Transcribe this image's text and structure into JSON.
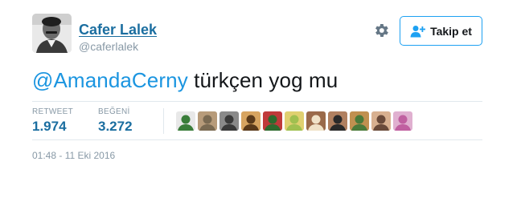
{
  "user": {
    "name": "Cafer Lalek",
    "handle": "@caferlalek",
    "avatar_icon": "profile-photo"
  },
  "actions": {
    "settings_icon": "gear-icon",
    "follow_label": "Takip et",
    "follow_icon": "add-user-icon",
    "accent_color": "#1da1f2"
  },
  "tweet": {
    "mention": "@AmandaCerny",
    "text": " türkçen yog mu"
  },
  "stats": {
    "retweet_label": "RETWEET",
    "retweet_value": "1.974",
    "likes_label": "BEĞENİ",
    "likes_value": "3.272"
  },
  "likers": [
    {
      "name": "liker-1",
      "c1": "#3a7d3a",
      "c2": "#e8e8e8"
    },
    {
      "name": "liker-2",
      "c1": "#7a6a52",
      "c2": "#b79b7a"
    },
    {
      "name": "liker-3",
      "c1": "#3a3a3a",
      "c2": "#8a8a8a"
    },
    {
      "name": "liker-4",
      "c1": "#5a3a1a",
      "c2": "#d7a460"
    },
    {
      "name": "liker-5",
      "c1": "#2e6b2e",
      "c2": "#c03a3a"
    },
    {
      "name": "liker-6",
      "c1": "#a0c050",
      "c2": "#e0d070"
    },
    {
      "name": "liker-7",
      "c1": "#f0e2c8",
      "c2": "#9a6a4a"
    },
    {
      "name": "liker-8",
      "c1": "#2a2a2a",
      "c2": "#b08060"
    },
    {
      "name": "liker-9",
      "c1": "#4a7a3a",
      "c2": "#c09050"
    },
    {
      "name": "liker-10",
      "c1": "#6a4a3a",
      "c2": "#d8b090"
    },
    {
      "name": "liker-11",
      "c1": "#c060a0",
      "c2": "#e0b0d0"
    }
  ],
  "timestamp": "01:48 - 11 Eki 2016"
}
